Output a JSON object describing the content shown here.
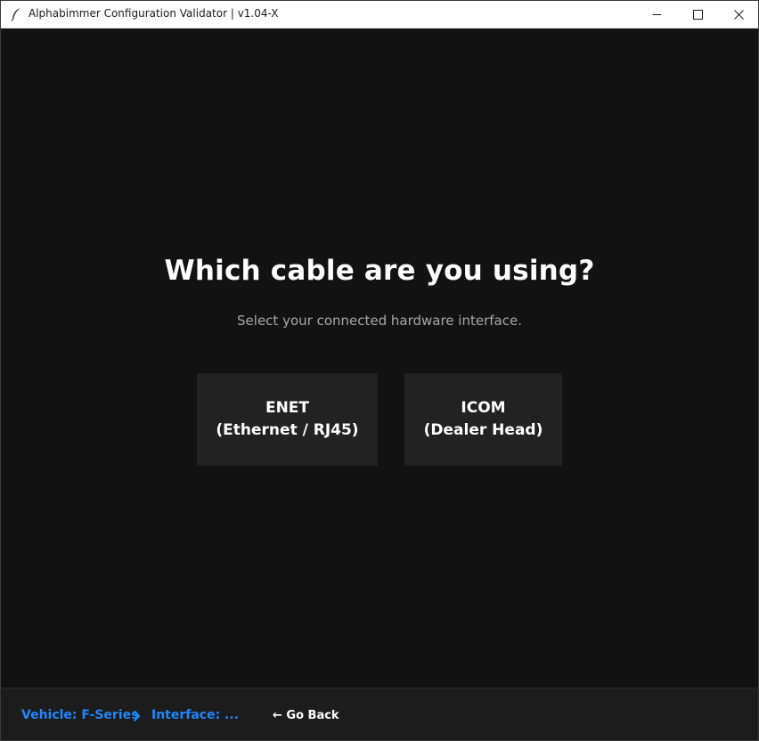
{
  "window": {
    "title": "Alphabimmer Configuration Validator | v1.04-X",
    "app_icon": "feather-icon",
    "controls": {
      "minimize_icon": "minimize-icon",
      "maximize_icon": "maximize-icon",
      "close_icon": "close-icon"
    }
  },
  "main": {
    "heading": "Which cable are you using?",
    "subheading": "Select your connected hardware interface.",
    "options": [
      {
        "line1": "ENET",
        "line2": "(Ethernet / RJ45)"
      },
      {
        "line1": "ICOM",
        "line2": "(Dealer Head)"
      }
    ]
  },
  "footer": {
    "breadcrumb": {
      "vehicle": "Vehicle: F-Series",
      "separator_icon": "chevron-right-icon",
      "interface": "Interface: ..."
    },
    "go_back": "← Go Back"
  },
  "colors": {
    "background": "#121212",
    "card": "#222222",
    "accent": "#1e88ff",
    "footer": "#1c1c1c"
  }
}
